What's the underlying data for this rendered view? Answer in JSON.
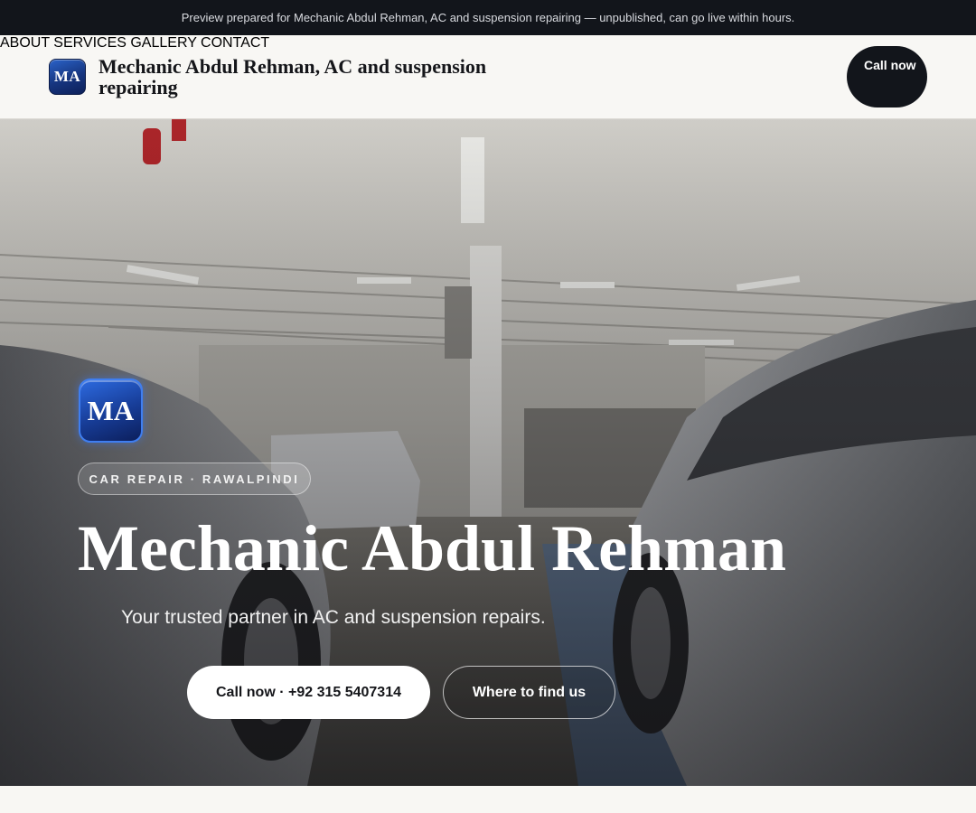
{
  "preview_banner": "Preview prepared for Mechanic Abdul Rehman, AC and suspension repairing — unpublished, can go live within hours.",
  "header": {
    "logo_initials": "MA",
    "brand_name": "Mechanic Abdul Rehman, AC and suspension repairing",
    "nav": [
      "ABOUT",
      "SERVICES",
      "GALLERY",
      "CONTACT"
    ],
    "cta_label": "Call now"
  },
  "hero": {
    "logo_initials": "MA",
    "eyebrow": "CAR REPAIR · RAWALPINDI",
    "title": "Mechanic Abdul Rehman",
    "tagline": "Your trusted partner in AC and suspension repairs.",
    "primary_button": "Call now · +92 315 5407314",
    "secondary_button": "Where to find us"
  },
  "colors": {
    "dark": "#12151b",
    "header_bg": "#f8f7f4",
    "logo_blue": "#173c96",
    "white": "#ffffff"
  },
  "icons": [
    "logo-badge-icon"
  ]
}
